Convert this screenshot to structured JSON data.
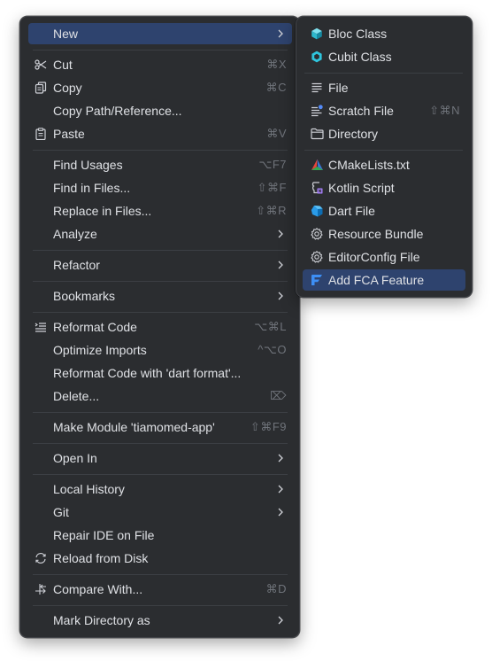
{
  "main_menu": {
    "items": [
      {
        "label": "New",
        "has_submenu": true
      },
      {
        "label": "Cut",
        "shortcut": "⌘X"
      },
      {
        "label": "Copy",
        "shortcut": "⌘C"
      },
      {
        "label": "Copy Path/Reference..."
      },
      {
        "label": "Paste",
        "shortcut": "⌘V"
      },
      {
        "label": "Find Usages",
        "shortcut": "⌥F7"
      },
      {
        "label": "Find in Files...",
        "shortcut": "⇧⌘F"
      },
      {
        "label": "Replace in Files...",
        "shortcut": "⇧⌘R"
      },
      {
        "label": "Analyze",
        "has_submenu": true
      },
      {
        "label": "Refactor",
        "has_submenu": true
      },
      {
        "label": "Bookmarks",
        "has_submenu": true
      },
      {
        "label": "Reformat Code",
        "shortcut": "⌥⌘L"
      },
      {
        "label": "Optimize Imports",
        "shortcut": "^⌥O"
      },
      {
        "label": "Reformat Code with 'dart format'..."
      },
      {
        "label": "Delete...",
        "shortcut": "⌦"
      },
      {
        "label": "Make Module 'tiamomed-app'",
        "shortcut": "⇧⌘F9"
      },
      {
        "label": "Open In",
        "has_submenu": true
      },
      {
        "label": "Local History",
        "has_submenu": true
      },
      {
        "label": "Git",
        "has_submenu": true
      },
      {
        "label": "Repair IDE on File"
      },
      {
        "label": "Reload from Disk"
      },
      {
        "label": "Compare With...",
        "shortcut": "⌘D"
      },
      {
        "label": "Mark Directory as",
        "has_submenu": true
      }
    ]
  },
  "new_submenu": {
    "items": [
      {
        "label": "Bloc Class",
        "icon": "bloc-cube-icon"
      },
      {
        "label": "Cubit Class",
        "icon": "cubit-hexagon-icon"
      },
      {
        "label": "File",
        "icon": "text-file-icon"
      },
      {
        "label": "Scratch File",
        "shortcut": "⇧⌘N",
        "icon": "scratch-file-icon"
      },
      {
        "label": "Directory",
        "icon": "folder-icon"
      },
      {
        "label": "CMakeLists.txt",
        "icon": "cmake-triangle-icon"
      },
      {
        "label": "Kotlin Script",
        "icon": "kotlin-script-icon"
      },
      {
        "label": "Dart File",
        "icon": "dart-icon"
      },
      {
        "label": "Resource Bundle",
        "icon": "resource-bundle-gear-icon"
      },
      {
        "label": "EditorConfig File",
        "icon": "editorconfig-gear-icon"
      },
      {
        "label": "Add FCA Feature",
        "icon": "fca-feature-icon",
        "selected": true
      }
    ]
  },
  "colors": {
    "menu_background": "#2b2d30",
    "selection": "#2e436e",
    "text": "#dfe1e5",
    "shortcut_text": "#6f737a",
    "separator": "#3c3f44"
  }
}
